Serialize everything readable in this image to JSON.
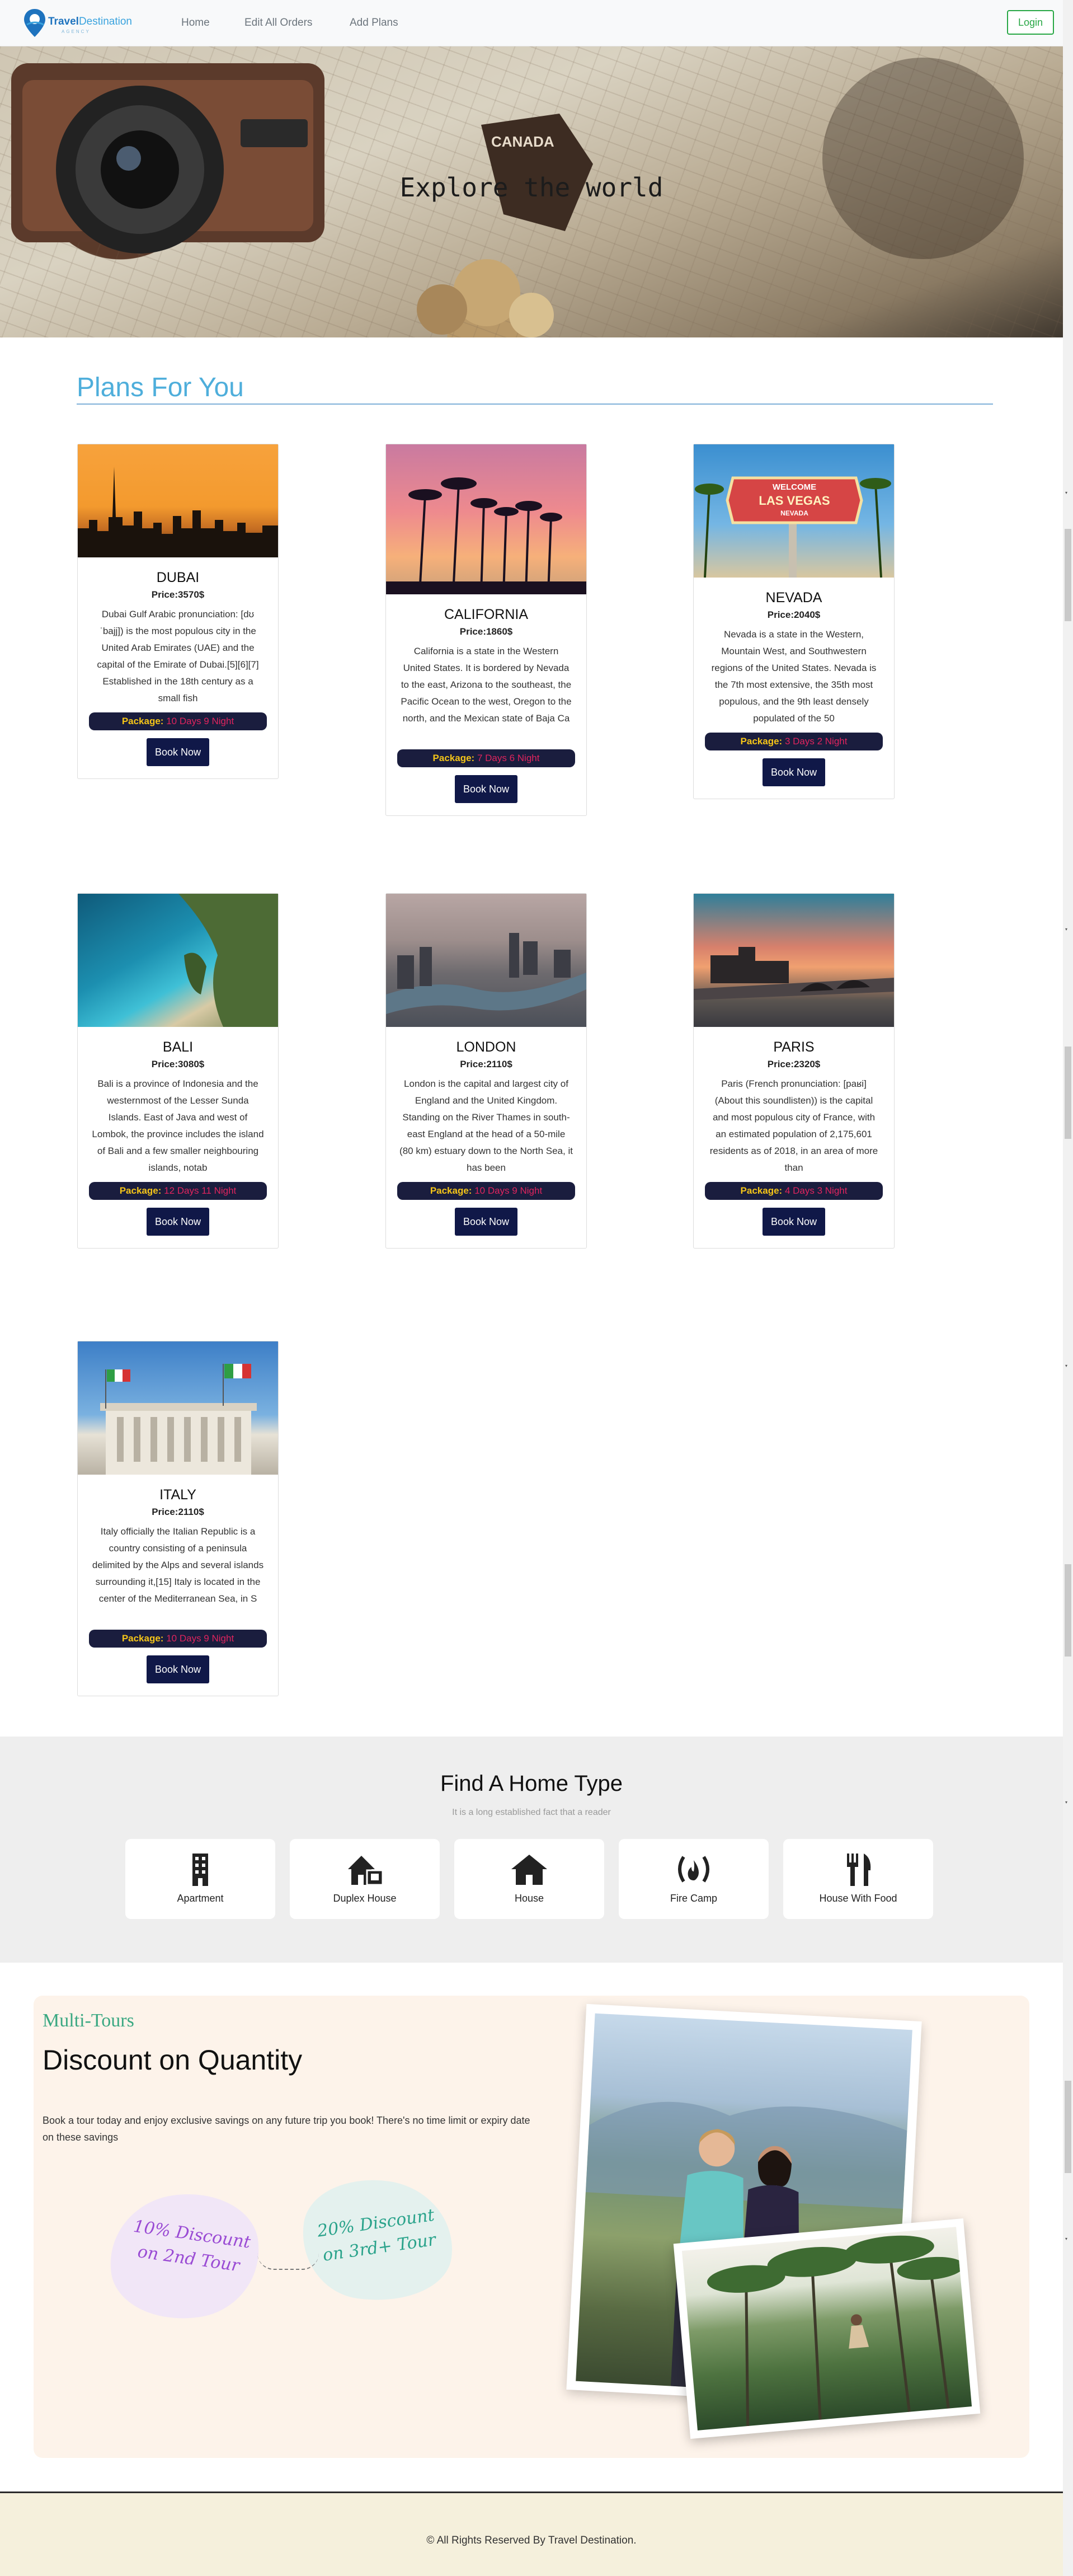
{
  "navbar": {
    "brand_main": "Travel",
    "brand_accent": "Destination",
    "brand_sub": "AGENCY",
    "links": [
      "Home",
      "Edit All Orders",
      "Add Plans"
    ],
    "login": "Login"
  },
  "hero": {
    "title": "Explore the world"
  },
  "plans": {
    "heading": "Plans For You",
    "package_label": "Package:",
    "book_label": "Book Now",
    "items": [
      {
        "name": "DUBAI",
        "price": "Price:3570$",
        "desc": "Dubai Gulf Arabic pronunciation: [dʊˈbajj]) is the most populous city in the United Arab Emirates (UAE) and the capital of the Emirate of Dubai.[5][6][7] Established in the 18th century as a small fish",
        "package": "10 Days 9 Night"
      },
      {
        "name": "CALIFORNIA",
        "price": "Price:1860$",
        "desc": "California is a state in the Western United States. It is bordered by Nevada to the east, Arizona to the southeast, the Pacific Ocean to the west, Oregon to the north, and the Mexican state of Baja Ca",
        "package": "7 Days 6 Night"
      },
      {
        "name": "NEVADA",
        "price": "Price:2040$",
        "desc": "Nevada is a state in the Western, Mountain West, and Southwestern regions of the United States. Nevada is the 7th most extensive, the 35th most populous, and the 9th least densely populated of the 50",
        "package": "3 Days 2 Night"
      },
      {
        "name": "BALI",
        "price": "Price:3080$",
        "desc": "Bali is a province of Indonesia and the westernmost of the Lesser Sunda Islands. East of Java and west of Lombok, the province includes the island of Bali and a few smaller neighbouring islands, notab",
        "package": "12 Days 11 Night"
      },
      {
        "name": "LONDON",
        "price": "Price:2110$",
        "desc": "London is the capital and largest city of England and the United Kingdom. Standing on the River Thames in south-east England at the head of a 50-mile (80 km) estuary down to the North Sea, it has been",
        "package": "10 Days 9 Night"
      },
      {
        "name": "PARIS",
        "price": "Price:2320$",
        "desc": "Paris (French pronunciation: [paʁi] (About this soundlisten)) is the capital and most populous city of France, with an estimated population of 2,175,601 residents as of 2018, in an area of more than",
        "package": "4 Days 3 Night"
      },
      {
        "name": "ITALY",
        "price": "Price:2110$",
        "desc": "Italy officially the Italian Republic is a country consisting of a peninsula delimited by the Alps and several islands surrounding it,[15] Italy is located in the center of the Mediterranean Sea, in S",
        "package": "10 Days 9 Night"
      }
    ]
  },
  "homes": {
    "title": "Find A Home Type",
    "subtitle": "It is a long established fact that a reader",
    "types": [
      {
        "label": "Apartment",
        "icon": "building-icon"
      },
      {
        "label": "Duplex House",
        "icon": "duplex-house-icon"
      },
      {
        "label": "House",
        "icon": "house-icon"
      },
      {
        "label": "Fire Camp",
        "icon": "campfire-icon"
      },
      {
        "label": "House With Food",
        "icon": "utensils-icon"
      }
    ]
  },
  "discount": {
    "brand": "Multi-Tours",
    "title": "Discount on Quantity",
    "text": "Book a tour today and enjoy exclusive savings on any future trip you book! There's no time limit or expiry date on these savings",
    "badge1": "10% Discount on 2nd Tour",
    "badge2": "20% Discount on 3rd+ Tour"
  },
  "hero_sign": {
    "canada": "CANADA",
    "vegas": "LAS VEGAS",
    "welcome": "WELCOME",
    "nevada": "NEVADA"
  },
  "footer": {
    "text": "© All Rights Reserved By Travel Destination."
  },
  "colors": {
    "accent": "#4eaedb",
    "navy": "#101848",
    "package_bg": "#1a1d3e",
    "package_label": "#f5c518",
    "package_value": "#e0245e",
    "brand_green": "#3aa882"
  }
}
